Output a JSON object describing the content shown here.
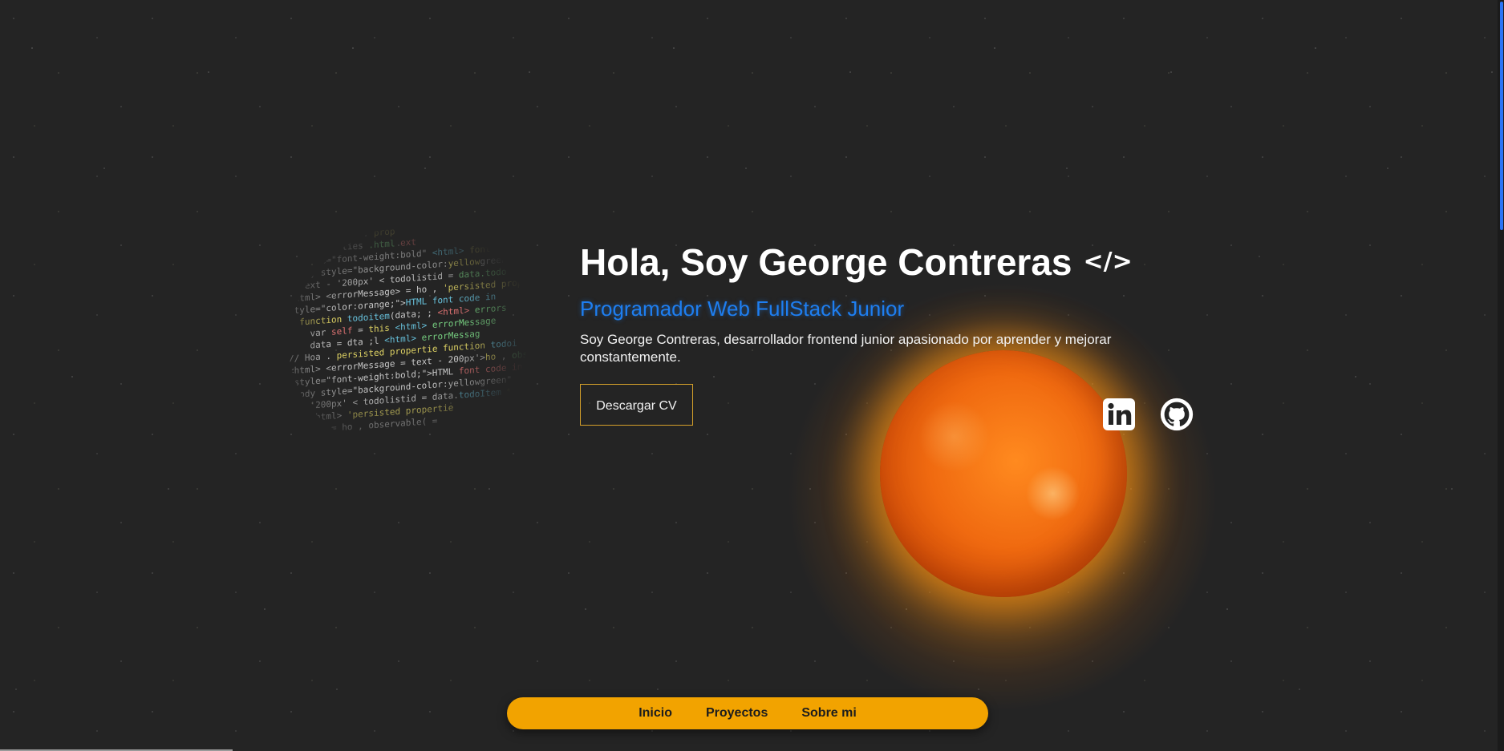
{
  "hero": {
    "title": "Hola, Soy George Contreras",
    "title_icon": "code-icon",
    "subtitle": "Programador Web FullStack Junior",
    "description": "Soy George Contreras, desarrollador frontend junior apasionado por aprender y mejorar constantemente.",
    "cv_button_label": "Descargar CV"
  },
  "socials": [
    {
      "name": "linkedin",
      "icon": "linkedin-icon"
    },
    {
      "name": "github",
      "icon": "github-icon"
    }
  ],
  "nav": {
    "items": [
      {
        "label": "Inicio"
      },
      {
        "label": "Proyectos"
      },
      {
        "label": "Sobre mi"
      }
    ]
  },
  "colors": {
    "background": "#242424",
    "subtitle": "#1e7ef0",
    "nav_background": "#f2a300",
    "cv_border": "#d4a02a",
    "sun": "#f06a10",
    "scroll_thumb": "#2b74f5"
  }
}
